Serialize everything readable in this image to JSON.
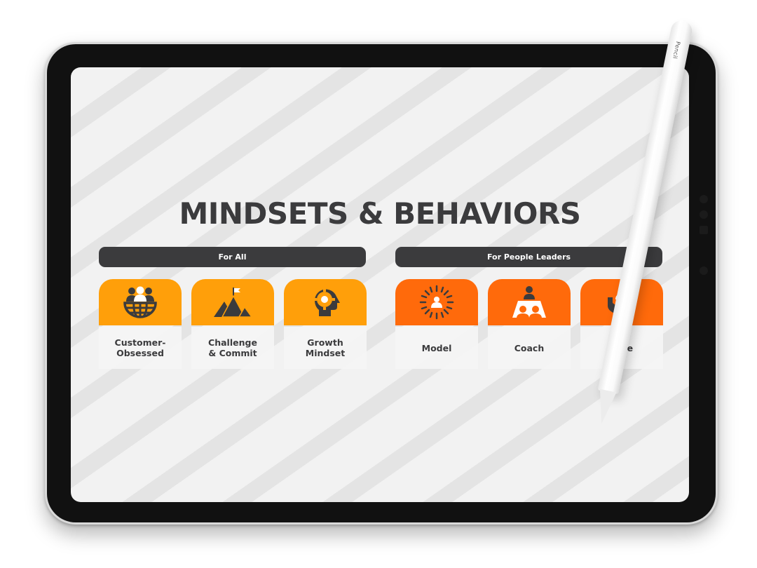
{
  "slide": {
    "title": "MINDSETS & BEHAVIORS",
    "groups": [
      {
        "label": "For All",
        "color": "#ff9f0a",
        "items": [
          {
            "label": "Customer-\nObsessed",
            "icon": "people-globe-icon"
          },
          {
            "label": "Challenge\n& Commit",
            "icon": "mountain-flag-icon"
          },
          {
            "label": "Growth\nMindset",
            "icon": "head-gear-icon"
          }
        ]
      },
      {
        "label": "For People Leaders",
        "color": "#ff6a0b",
        "items": [
          {
            "label": "Model",
            "icon": "person-radiant-icon"
          },
          {
            "label": "Coach",
            "icon": "coach-table-icon"
          },
          {
            "label": "Care",
            "icon": "hands-person-icon"
          }
        ]
      }
    ]
  },
  "device": {
    "pencil_brand": "Pencil"
  },
  "colors": {
    "title": "#3b3b3d",
    "bar": "#3b3b3d",
    "for_all_accent": "#ff9f0a",
    "leaders_accent": "#ff6a0b"
  }
}
